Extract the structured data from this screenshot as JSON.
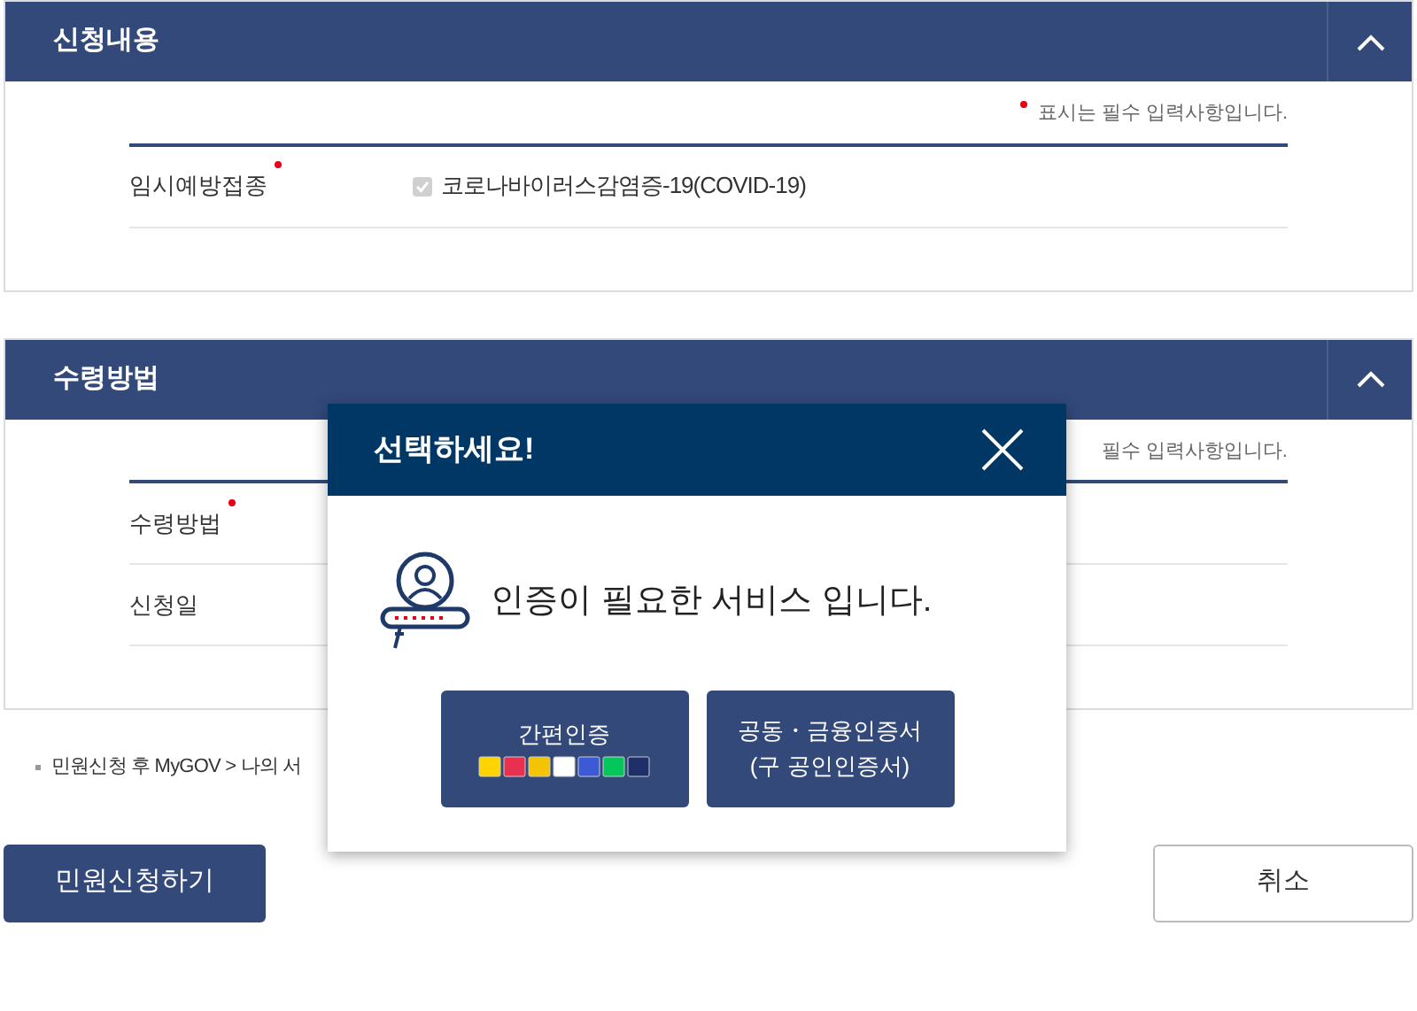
{
  "sections": [
    {
      "title": "신청내용",
      "expanded": true,
      "required_note": "표시는 필수 입력사항입니다.",
      "rows": [
        {
          "label": "임시예방접종",
          "required": true,
          "kind": "checkbox",
          "value": "코로나바이러스감염증-19(COVID-19)",
          "checked": true,
          "disabled": true
        }
      ]
    },
    {
      "title": "수령방법",
      "expanded": true,
      "note_dot": false,
      "required_note": "필수 입력사항입니다.",
      "rows": [
        {
          "label": "수령방법",
          "required": true,
          "kind": "empty"
        },
        {
          "label": "신청일",
          "required": false,
          "kind": "empty"
        }
      ]
    }
  ],
  "note": "민원신청 후 MyGOV > 나의 서",
  "buttons": [
    {
      "label": "민원신청하기",
      "kind": "primary"
    },
    {
      "label": "취소",
      "kind": "secondary"
    }
  ],
  "modal": {
    "title": "선택하세요!",
    "message": "인증이 필요한 서비스 입니다.",
    "options": [
      {
        "label": "간편인증",
        "kind": "simple"
      },
      {
        "label": "공동・금융인증서",
        "sublabel": "(구 공인인증서)",
        "kind": "certificate"
      }
    ]
  }
}
